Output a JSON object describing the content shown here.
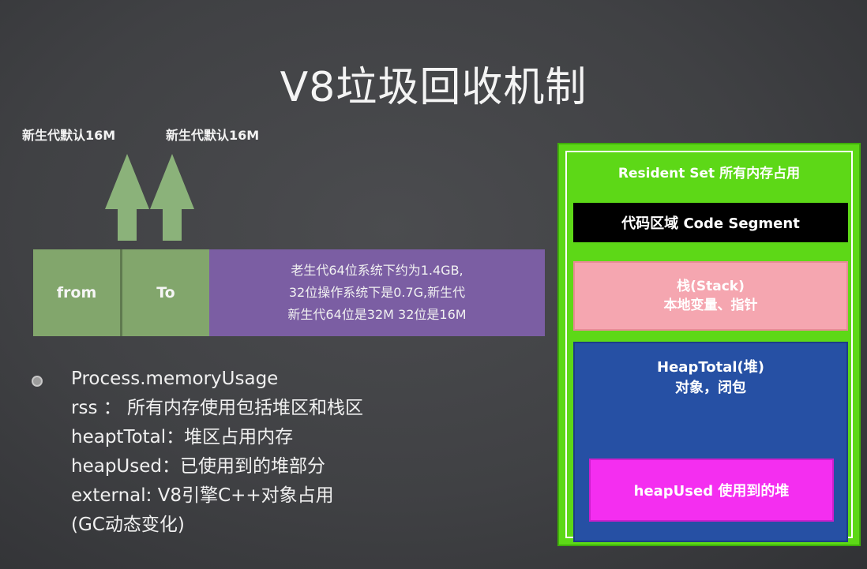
{
  "title": "V8垃圾回收机制",
  "arrow_labels": [
    "新生代默认16M",
    "新生代默认16M"
  ],
  "memory_bar": {
    "from": "from",
    "to": "To",
    "old_gen_lines": [
      "老生代64位系统下约为1.4GB,",
      "32位操作系统下是0.7G,新生代",
      "新生代64位是32M 32位是16M"
    ]
  },
  "notes": [
    "Process.memoryUsage",
    "rss ： 所有内存使用包括堆区和栈区",
    "heaptTotal：堆区占用内存",
    "heapUsed：已使用到的堆部分",
    "external: V8引擎C++对象占用",
    "(GC动态变化)"
  ],
  "memory_panel": {
    "resident": "Resident Set 所有内存占用",
    "code_segment": "代码区域 Code Segment",
    "stack_title": "栈(Stack)",
    "stack_desc": "本地变量、指针",
    "heap_title": "HeapTotal(堆)",
    "heap_desc": "对象，闭包",
    "heap_used": "heapUsed 使用到的堆"
  },
  "colors": {
    "background": "#404144",
    "young_gen": "#82a66c",
    "old_gen": "#7b5ea3",
    "arrow": "#8bb27a",
    "panel": "#5dd817",
    "code_segment": "#000000",
    "stack": "#f5a6b0",
    "heap": "#2650a4",
    "heap_used": "#f42ef0"
  }
}
